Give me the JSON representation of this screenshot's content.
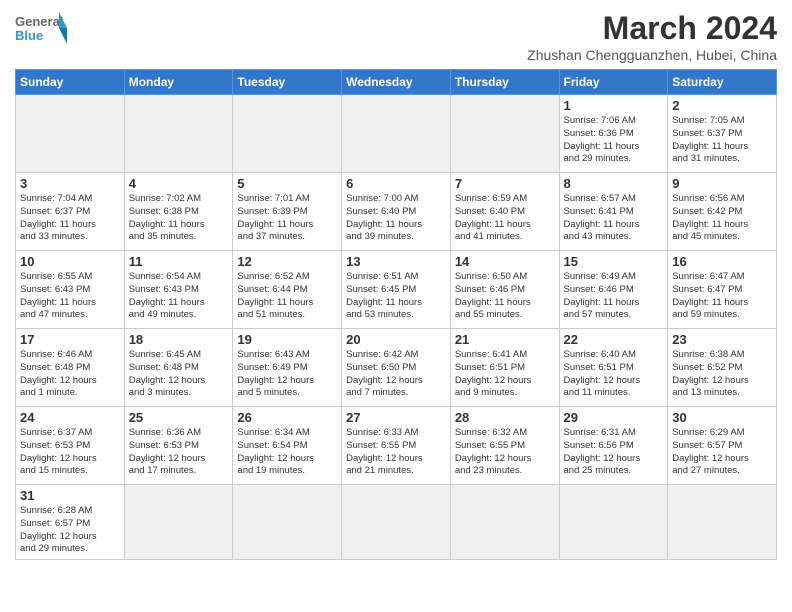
{
  "header": {
    "logo_general": "General",
    "logo_blue": "Blue",
    "month_year": "March 2024",
    "location": "Zhushan Chengguanzhen, Hubei, China"
  },
  "weekdays": [
    "Sunday",
    "Monday",
    "Tuesday",
    "Wednesday",
    "Thursday",
    "Friday",
    "Saturday"
  ],
  "weeks": [
    [
      {
        "day": "",
        "info": ""
      },
      {
        "day": "",
        "info": ""
      },
      {
        "day": "",
        "info": ""
      },
      {
        "day": "",
        "info": ""
      },
      {
        "day": "",
        "info": ""
      },
      {
        "day": "1",
        "info": "Sunrise: 7:06 AM\nSunset: 6:36 PM\nDaylight: 11 hours\nand 29 minutes."
      },
      {
        "day": "2",
        "info": "Sunrise: 7:05 AM\nSunset: 6:37 PM\nDaylight: 11 hours\nand 31 minutes."
      }
    ],
    [
      {
        "day": "3",
        "info": "Sunrise: 7:04 AM\nSunset: 6:37 PM\nDaylight: 11 hours\nand 33 minutes."
      },
      {
        "day": "4",
        "info": "Sunrise: 7:02 AM\nSunset: 6:38 PM\nDaylight: 11 hours\nand 35 minutes."
      },
      {
        "day": "5",
        "info": "Sunrise: 7:01 AM\nSunset: 6:39 PM\nDaylight: 11 hours\nand 37 minutes."
      },
      {
        "day": "6",
        "info": "Sunrise: 7:00 AM\nSunset: 6:40 PM\nDaylight: 11 hours\nand 39 minutes."
      },
      {
        "day": "7",
        "info": "Sunrise: 6:59 AM\nSunset: 6:40 PM\nDaylight: 11 hours\nand 41 minutes."
      },
      {
        "day": "8",
        "info": "Sunrise: 6:57 AM\nSunset: 6:41 PM\nDaylight: 11 hours\nand 43 minutes."
      },
      {
        "day": "9",
        "info": "Sunrise: 6:56 AM\nSunset: 6:42 PM\nDaylight: 11 hours\nand 45 minutes."
      }
    ],
    [
      {
        "day": "10",
        "info": "Sunrise: 6:55 AM\nSunset: 6:43 PM\nDaylight: 11 hours\nand 47 minutes."
      },
      {
        "day": "11",
        "info": "Sunrise: 6:54 AM\nSunset: 6:43 PM\nDaylight: 11 hours\nand 49 minutes."
      },
      {
        "day": "12",
        "info": "Sunrise: 6:52 AM\nSunset: 6:44 PM\nDaylight: 11 hours\nand 51 minutes."
      },
      {
        "day": "13",
        "info": "Sunrise: 6:51 AM\nSunset: 6:45 PM\nDaylight: 11 hours\nand 53 minutes."
      },
      {
        "day": "14",
        "info": "Sunrise: 6:50 AM\nSunset: 6:46 PM\nDaylight: 11 hours\nand 55 minutes."
      },
      {
        "day": "15",
        "info": "Sunrise: 6:49 AM\nSunset: 6:46 PM\nDaylight: 11 hours\nand 57 minutes."
      },
      {
        "day": "16",
        "info": "Sunrise: 6:47 AM\nSunset: 6:47 PM\nDaylight: 11 hours\nand 59 minutes."
      }
    ],
    [
      {
        "day": "17",
        "info": "Sunrise: 6:46 AM\nSunset: 6:48 PM\nDaylight: 12 hours\nand 1 minute."
      },
      {
        "day": "18",
        "info": "Sunrise: 6:45 AM\nSunset: 6:48 PM\nDaylight: 12 hours\nand 3 minutes."
      },
      {
        "day": "19",
        "info": "Sunrise: 6:43 AM\nSunset: 6:49 PM\nDaylight: 12 hours\nand 5 minutes."
      },
      {
        "day": "20",
        "info": "Sunrise: 6:42 AM\nSunset: 6:50 PM\nDaylight: 12 hours\nand 7 minutes."
      },
      {
        "day": "21",
        "info": "Sunrise: 6:41 AM\nSunset: 6:51 PM\nDaylight: 12 hours\nand 9 minutes."
      },
      {
        "day": "22",
        "info": "Sunrise: 6:40 AM\nSunset: 6:51 PM\nDaylight: 12 hours\nand 11 minutes."
      },
      {
        "day": "23",
        "info": "Sunrise: 6:38 AM\nSunset: 6:52 PM\nDaylight: 12 hours\nand 13 minutes."
      }
    ],
    [
      {
        "day": "24",
        "info": "Sunrise: 6:37 AM\nSunset: 6:53 PM\nDaylight: 12 hours\nand 15 minutes."
      },
      {
        "day": "25",
        "info": "Sunrise: 6:36 AM\nSunset: 6:53 PM\nDaylight: 12 hours\nand 17 minutes."
      },
      {
        "day": "26",
        "info": "Sunrise: 6:34 AM\nSunset: 6:54 PM\nDaylight: 12 hours\nand 19 minutes."
      },
      {
        "day": "27",
        "info": "Sunrise: 6:33 AM\nSunset: 6:55 PM\nDaylight: 12 hours\nand 21 minutes."
      },
      {
        "day": "28",
        "info": "Sunrise: 6:32 AM\nSunset: 6:55 PM\nDaylight: 12 hours\nand 23 minutes."
      },
      {
        "day": "29",
        "info": "Sunrise: 6:31 AM\nSunset: 6:56 PM\nDaylight: 12 hours\nand 25 minutes."
      },
      {
        "day": "30",
        "info": "Sunrise: 6:29 AM\nSunset: 6:57 PM\nDaylight: 12 hours\nand 27 minutes."
      }
    ],
    [
      {
        "day": "31",
        "info": "Sunrise: 6:28 AM\nSunset: 6:57 PM\nDaylight: 12 hours\nand 29 minutes."
      },
      {
        "day": "",
        "info": ""
      },
      {
        "day": "",
        "info": ""
      },
      {
        "day": "",
        "info": ""
      },
      {
        "day": "",
        "info": ""
      },
      {
        "day": "",
        "info": ""
      },
      {
        "day": "",
        "info": ""
      }
    ]
  ]
}
